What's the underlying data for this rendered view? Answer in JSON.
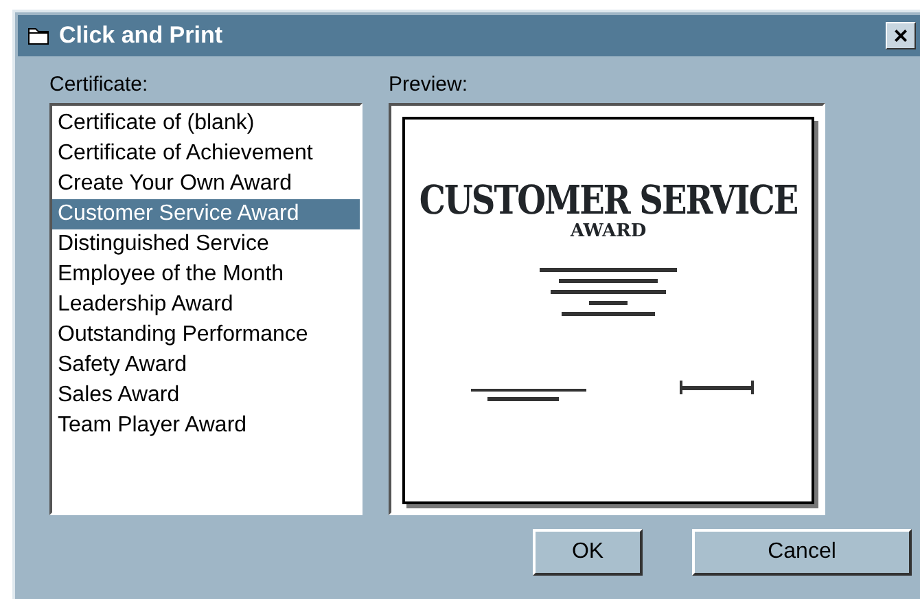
{
  "window": {
    "title": "Click and Print",
    "close": "×"
  },
  "certificate": {
    "label": "Certificate:",
    "items": [
      {
        "label": "Certificate of (blank)",
        "selected": false
      },
      {
        "label": "Certificate of Achievement",
        "selected": false
      },
      {
        "label": "Create Your Own Award",
        "selected": false
      },
      {
        "label": "Customer Service Award",
        "selected": true
      },
      {
        "label": "Distinguished Service",
        "selected": false
      },
      {
        "label": "Employee of the Month",
        "selected": false
      },
      {
        "label": "Leadership Award",
        "selected": false
      },
      {
        "label": "Outstanding Performance",
        "selected": false
      },
      {
        "label": "Safety Award",
        "selected": false
      },
      {
        "label": "Sales Award",
        "selected": false
      },
      {
        "label": "Team Player Award",
        "selected": false
      }
    ]
  },
  "preview": {
    "label": "Preview:",
    "heading": "CUSTOMER SERVICE",
    "subheading": "AWARD"
  },
  "buttons": [
    "OK",
    "Cancel"
  ]
}
